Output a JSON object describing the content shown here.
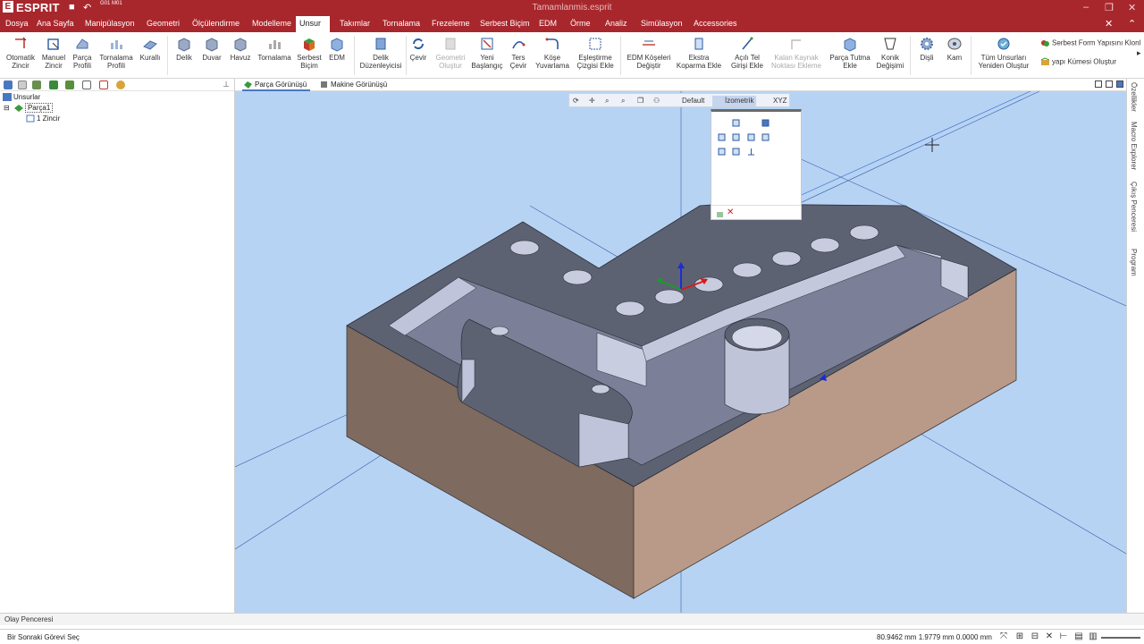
{
  "app": {
    "logo": "ESPRIT",
    "gcode_badge": "G01 M01",
    "document_title": "Tamamlanmis.esprit"
  },
  "ribbon_tabs": [
    "Dosya",
    "Ana Sayfa",
    "Manipülasyon",
    "Geometri",
    "Ölçülendirme",
    "Modelleme",
    "Unsur",
    "Takımlar",
    "Tornalama",
    "Frezeleme",
    "Serbest Biçim",
    "EDM",
    "Örme",
    "Analiz",
    "Simülasyon",
    "Accessories"
  ],
  "active_tab": "Unsur",
  "ribbon": {
    "otomatik_zincir": "Otomatik Zincir",
    "manuel_zincir": "Manuel Zincir",
    "parca_profili": "Parça Profili",
    "tornalama_profili": "Tornalama Profili",
    "kuralli": "Kurallı",
    "delik": "Delik",
    "duvar": "Duvar",
    "havuz": "Havuz",
    "tornalama": "Tornalama",
    "serbest_bicim": "Serbest Biçim",
    "edm": "EDM",
    "delik_duzenleyicisi": "Delik Düzenleyicisi",
    "cevir": "Çevir",
    "geometri_olustur": "Geometri Oluştur",
    "yeni_baslangic": "Yeni Başlangıç",
    "ters_cevir": "Ters Çevir",
    "kose_yuvarlama": "Köşe Yuvarlama",
    "eslestirme_cizgisi": "Eşleştirme Çizgisi Ekle",
    "edm_koseleri": "EDM Köşeleri Değiştir",
    "ekstra_koparma": "Ekstra Koparma Ekle",
    "acili_tel": "Açılı Tel Girişi Ekle",
    "kalan_kaynak": "Kalan Kaynak Noktası Ekleme",
    "parca_tutma": "Parça Tutma Ekle",
    "konik_degisimi": "Konik Değişimi",
    "disli": "Dişli",
    "kam": "Kam",
    "tum_unsurlari": "Tüm Unsurları Yeniden Oluştur",
    "serbest_form_klon": "Serbest Form Yapısını Klonl",
    "yapi_kumesi": "yapı Kümesi Oluştur"
  },
  "tree": {
    "root": "Unsurlar",
    "part": "Parça1",
    "chain": "1 Zincir"
  },
  "view_tabs": {
    "parca": "Parça Görünüşü",
    "makine": "Makine Görünüşü"
  },
  "view_toolbar": {
    "default": "Default",
    "izometrik": "İzometrik",
    "xyz": "XYZ"
  },
  "right_tabs": [
    "Özellikler",
    "Macro Explorer",
    "Çıkış Penceresi",
    "Program"
  ],
  "event_panel": "Olay Penceresi",
  "status": {
    "message": "Bir Sonraki Görevi Seç",
    "coords": "80.9462 mm  1.9779 mm  0.0000 mm"
  },
  "colors": {
    "brand": "#a8272d",
    "viewport": "#b7d3f4",
    "part_top": "#5d6273",
    "part_front": "#7e6a5f",
    "part_side": "#b99a88"
  }
}
